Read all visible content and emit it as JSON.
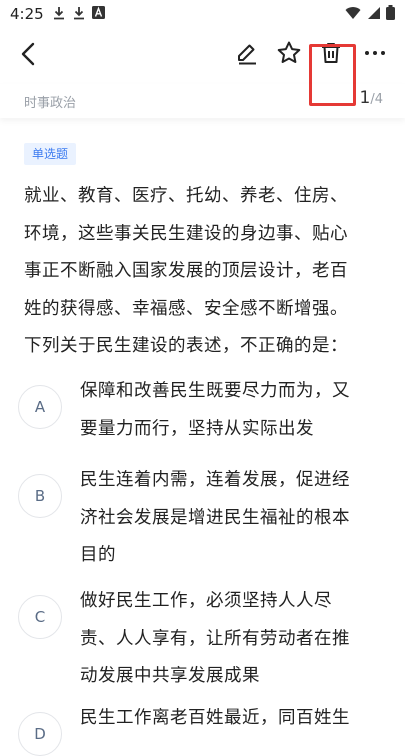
{
  "status_bar": {
    "time": "4:25",
    "icons": [
      "download-icon",
      "download-icon",
      "font-icon"
    ],
    "right_icons": [
      "wifi-icon",
      "signal-icon",
      "battery-icon"
    ]
  },
  "toolbar": {
    "icons": [
      "back-arrow-icon",
      "edit-icon",
      "star-icon",
      "trash-icon",
      "more-icon"
    ],
    "highlight_color": "#e53935"
  },
  "subheader": {
    "category": "时事政治",
    "current": "1",
    "total": "/4"
  },
  "question": {
    "type_tag": "单选题",
    "lines": [
      "就业、教育、医疗、托幼、养老、住房、",
      "环境，这些事关民生建设的身边事、贴心",
      "事正不断融入国家发展的顶层设计，老百",
      "姓的获得感、幸福感、安全感不断增强。",
      "下列关于民生建设的表述，不正确的是："
    ]
  },
  "options": [
    {
      "letter": "A",
      "lines": [
        "保障和改善民生既要尽力而为，又",
        "要量力而行，坚持从实际出发"
      ]
    },
    {
      "letter": "B",
      "lines": [
        "民生连着内需，连着发展，促进经",
        "济社会发展是增进民生福祉的根本",
        "目的"
      ]
    },
    {
      "letter": "C",
      "lines": [
        "做好民生工作，必须坚持人人尽",
        "责、人人享有，让所有劳动者在推",
        "动发展中共享发展成果"
      ]
    },
    {
      "letter": "D",
      "lines": [
        "民生工作离老百姓最近，同百姓生"
      ]
    }
  ],
  "colors": {
    "accent": "#3c7bf0",
    "tag_bg": "#eaf2ff",
    "muted": "#9aa0a8"
  }
}
